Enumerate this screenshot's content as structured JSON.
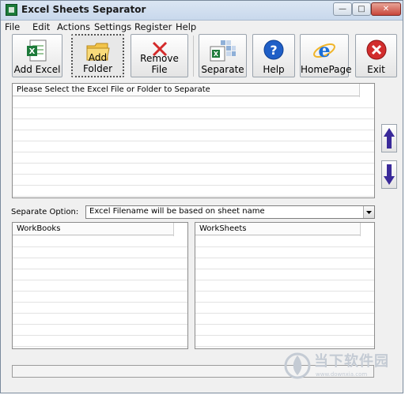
{
  "window": {
    "title": "Excel Sheets Separator",
    "controls": {
      "minimize": "—",
      "maximize": "□",
      "close": "✕"
    }
  },
  "menu": [
    "File",
    "Edit",
    "Actions",
    "Settings",
    "Register",
    "Help"
  ],
  "toolbar": {
    "add_excel": "Add Excel",
    "add_folder": "Add Folder",
    "remove_file": "Remove File",
    "separate": "Separate",
    "help": "Help",
    "homepage": "HomePage",
    "exit": "Exit"
  },
  "file_list": {
    "header": "Please Select the Excel File or Folder to Separate",
    "items": []
  },
  "separate_option": {
    "label": "Separate Option:",
    "value": "Excel Filename will be based on sheet name"
  },
  "workbooks": {
    "header": "WorkBooks",
    "items": []
  },
  "worksheets": {
    "header": "WorkSheets",
    "items": []
  },
  "status_text": "",
  "watermark": {
    "brand": "当下软件园",
    "url": "www.downxia.com"
  },
  "colors": {
    "titlebar": "#c8d8ec",
    "exit_red": "#d22d2d",
    "help_blue": "#1f5fc7",
    "arrow_purple": "#3a2a9a"
  }
}
